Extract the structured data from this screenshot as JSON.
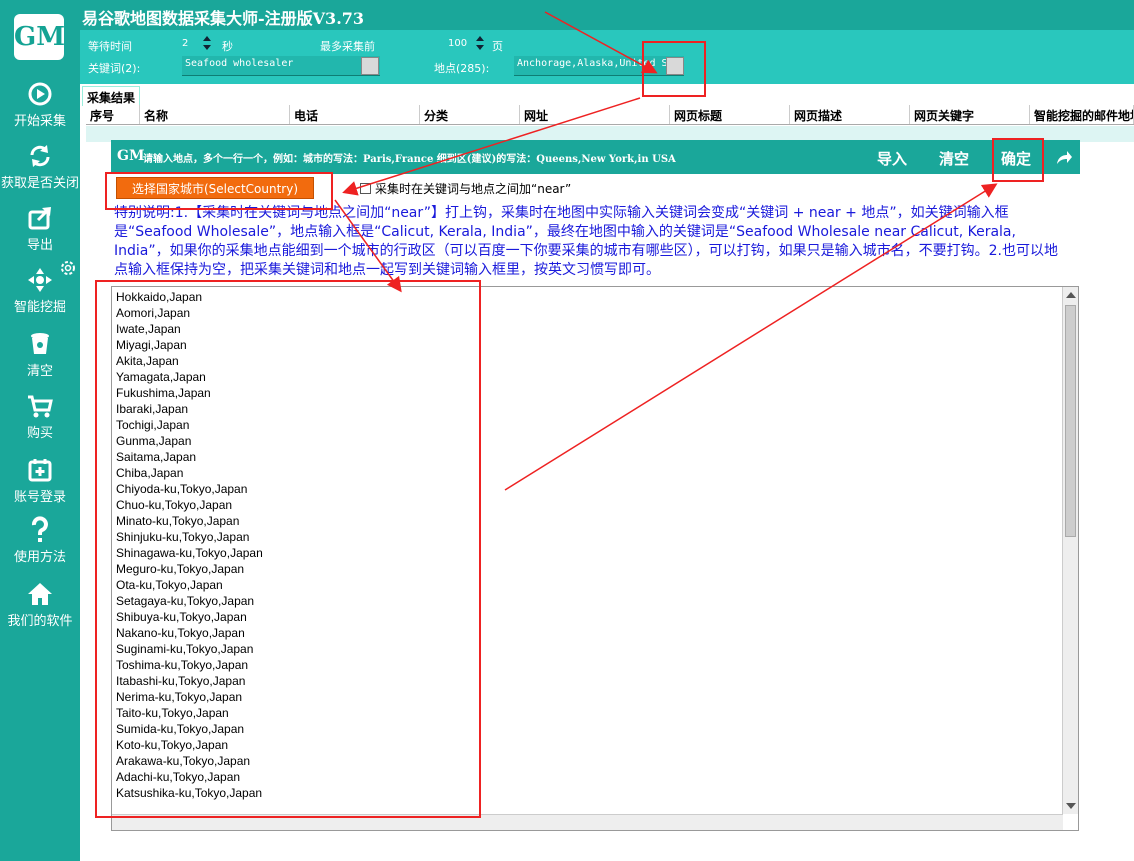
{
  "app": {
    "logo": "GM",
    "title": "易谷歌地图数据采集大师-注册版V3.73"
  },
  "sidebar": {
    "items": [
      {
        "label": "开始采集",
        "icon": "play-icon"
      },
      {
        "label": "获取是否关闭",
        "icon": "refresh-icon"
      },
      {
        "label": "导出",
        "icon": "export-icon"
      },
      {
        "label": "智能挖掘",
        "icon": "mining-icon"
      },
      {
        "label": "清空",
        "icon": "trash-icon"
      },
      {
        "label": "购买",
        "icon": "cart-icon"
      },
      {
        "label": "账号登录",
        "icon": "calendar-plus-icon"
      },
      {
        "label": "使用方法",
        "icon": "question-icon"
      },
      {
        "label": "我们的软件",
        "icon": "home-icon"
      }
    ]
  },
  "settings": {
    "wait_label": "等待时间",
    "wait_value": "2",
    "wait_unit": "秒",
    "max_label": "最多采集前",
    "max_value": "100",
    "max_unit": "页",
    "keyword_label": "关键词(2):",
    "keyword_value": "Seafood wholesaler",
    "location_label": "地点(285):",
    "location_value": "Anchorage,Alaska,United S"
  },
  "results": {
    "tab": "采集结果",
    "columns": [
      "序号",
      "名称",
      "电话",
      "分类",
      "网址",
      "网页标题",
      "网页描述",
      "网页关键字",
      "智能挖掘的邮件地址"
    ]
  },
  "dialog": {
    "logo": "GM",
    "hint": "请输入地点，多个一行一个，例如：城市的写法：Paris,France 细到区(建议)的写法：Queens,New York,in USA",
    "import": "导入",
    "clear": "清空",
    "confirm": "确定",
    "select_country": "选择国家城市(SelectCountry)",
    "near_option": "采集时在关键词与地点之间加“near”",
    "note": "特别说明:1.【采集时在关键词与地点之间加“near”】打上钩，采集时在地图中实际输入关键词会变成“关键词 + near + 地点”，如关键词输入框是“Seafood Wholesale”，地点输入框是“Calicut, Kerala, India”，最终在地图中输入的关键词是“Seafood Wholesale near Calicut, Kerala, India”，如果你的采集地点能细到一个城市的行政区（可以百度一下你要采集的城市有哪些区），可以打钩，如果只是输入城市名，不要打钩。2.也可以地点输入框保持为空，把采集关键词和地点一起写到关键词输入框里，按英文习惯写即可。",
    "locations": [
      "Hokkaido,Japan",
      "Aomori,Japan",
      "Iwate,Japan",
      "Miyagi,Japan",
      "Akita,Japan",
      "Yamagata,Japan",
      "Fukushima,Japan",
      "Ibaraki,Japan",
      "Tochigi,Japan",
      "Gunma,Japan",
      "Saitama,Japan",
      "Chiba,Japan",
      "Chiyoda-ku,Tokyo,Japan",
      "Chuo-ku,Tokyo,Japan",
      "Minato-ku,Tokyo,Japan",
      "Shinjuku-ku,Tokyo,Japan",
      "Shinagawa-ku,Tokyo,Japan",
      "Meguro-ku,Tokyo,Japan",
      "Ota-ku,Tokyo,Japan",
      "Setagaya-ku,Tokyo,Japan",
      "Shibuya-ku,Tokyo,Japan",
      "Nakano-ku,Tokyo,Japan",
      "Suginami-ku,Tokyo,Japan",
      "Toshima-ku,Tokyo,Japan",
      "Itabashi-ku,Tokyo,Japan",
      "Nerima-ku,Tokyo,Japan",
      "Taito-ku,Tokyo,Japan",
      "Sumida-ku,Tokyo,Japan",
      "Koto-ku,Tokyo,Japan",
      "Arakawa-ku,Tokyo,Japan",
      "Adachi-ku,Tokyo,Japan",
      "Katsushika-ku,Tokyo,Japan"
    ]
  },
  "colors": {
    "sidebar": "#1aa79a",
    "settings": "#29c7bd",
    "orange": "#f26b0e",
    "annotation": "#ee2222",
    "note": "#1a1adb"
  }
}
